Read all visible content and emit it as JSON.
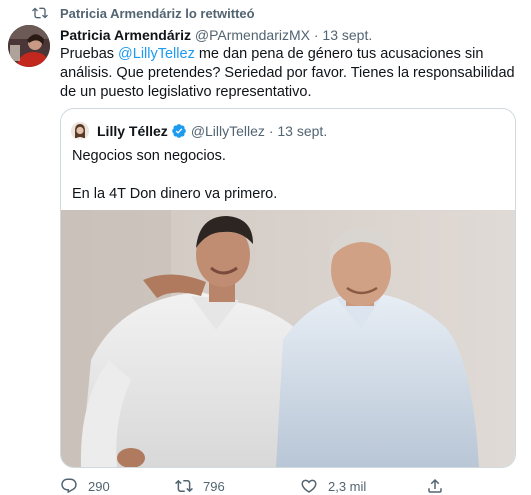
{
  "retweet": {
    "label": "Patricia Armendáriz lo retwitteó",
    "icon": "retweet-icon"
  },
  "tweet": {
    "author_name": "Patricia Armendáriz",
    "author_handle": "@PArmendarizMX",
    "separator": "·",
    "date": "13 sept.",
    "text_parts": {
      "before": "Pruebas ",
      "mention": "@LillyTellez",
      "after": " me dan pena de género tus acusaciones sin análisis. Que pretendes? Seriedad por favor. Tienes la responsabilidad de un puesto legislativo representativo."
    }
  },
  "quoted_tweet": {
    "author_name": "Lilly Téllez",
    "verified_icon": "verified-badge-icon",
    "author_handle": "@LillyTellez",
    "separator": "·",
    "date": "13 sept.",
    "lines": [
      "Negocios son negocios.",
      "En la 4T Don dinero va primero."
    ]
  },
  "actions": {
    "replies": "290",
    "retweets": "796",
    "likes": "2,3 mil",
    "icons": [
      "reply-icon",
      "retweet-icon",
      "like-icon",
      "share-icon"
    ]
  },
  "colors": {
    "accent": "#1d9bf0",
    "text": "#0f1419",
    "secondary_text": "#536471",
    "border": "#cfd9de"
  }
}
